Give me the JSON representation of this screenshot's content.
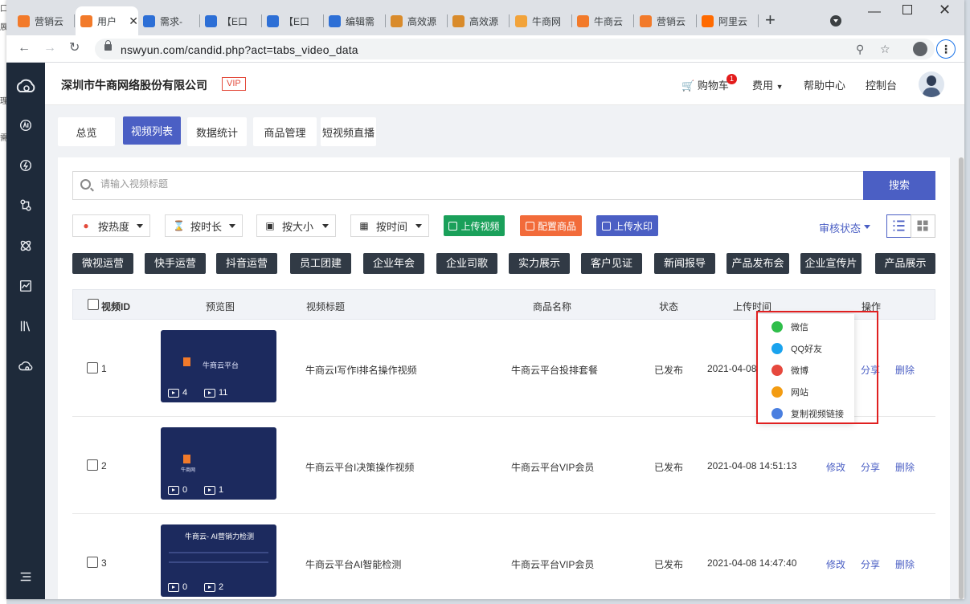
{
  "browser": {
    "tabs": [
      {
        "label": "营销云",
        "icon_color": "#f27a2a",
        "icon": "cloud-icon"
      },
      {
        "label": "用户",
        "icon_color": "#f27a2a",
        "icon": "cloud-icon",
        "active": true
      },
      {
        "label": "需求-",
        "icon_color": "#2d6fd6",
        "icon": "box-icon"
      },
      {
        "label": "【E口",
        "icon_color": "#2d6fd6",
        "icon": "box-icon"
      },
      {
        "label": "【E口",
        "icon_color": "#2d6fd6",
        "icon": "box-icon"
      },
      {
        "label": "编辑需",
        "icon_color": "#2d6fd6",
        "icon": "box-icon"
      },
      {
        "label": "高效源",
        "icon_color": "#d98b2b",
        "icon": "grid-icon"
      },
      {
        "label": "高效源",
        "icon_color": "#d98b2b",
        "icon": "grid-icon"
      },
      {
        "label": "牛商网",
        "icon_color": "#f2a33a",
        "icon": "bull-icon"
      },
      {
        "label": "牛商云",
        "icon_color": "#f27a2a",
        "icon": "cloud-icon"
      },
      {
        "label": "营销云",
        "icon_color": "#f27a2a",
        "icon": "cloud-icon"
      },
      {
        "label": "阿里云",
        "icon_color": "#ff6a00",
        "icon": "aliyun-icon"
      }
    ],
    "new_tab": "+",
    "url": "nswyun.com/candid.php?act=tabs_video_data"
  },
  "header": {
    "company": "深圳市牛商网络股份有限公司",
    "vip": "VIP",
    "cart": "购物车",
    "cart_count": "1",
    "fees": "费用",
    "help": "帮助中心",
    "console": "控制台"
  },
  "subtabs": [
    "总览",
    "视频列表",
    "数据统计",
    "商品管理",
    "短视频直播"
  ],
  "active_subtab": "视频列表",
  "search": {
    "placeholder": "请输入视频标题",
    "button": "搜索"
  },
  "filters": [
    "按热度",
    "按时长",
    "按大小",
    "按时间"
  ],
  "actions": {
    "upload_video": "上传视频",
    "config_product": "配置商品",
    "upload_watermark": "上传水印",
    "review_status": "审核状态"
  },
  "categories": [
    "微视运营",
    "快手运营",
    "抖音运营",
    "员工团建",
    "企业年会",
    "企业司歌",
    "实力展示",
    "客户见证",
    "新闻报导",
    "产品发布会",
    "企业宣传片",
    "产品展示"
  ],
  "table": {
    "columns": [
      "视频ID",
      "预览图",
      "视频标题",
      "商品名称",
      "状态",
      "上传时间",
      "操作"
    ],
    "rows": [
      {
        "id": "1",
        "title": "牛商云I写作I排名操作视频",
        "product": "牛商云平台投排套餐",
        "status": "已发布",
        "time": "2021-04-08",
        "plays": "4",
        "count": "11",
        "thumb_title": "牛商云平台"
      },
      {
        "id": "2",
        "title": "牛商云平台I决策操作视频",
        "product": "牛商云平台VIP会员",
        "status": "已发布",
        "time": "2021-04-08 14:51:13",
        "plays": "0",
        "count": "1",
        "thumb_title": "牛商网"
      },
      {
        "id": "3",
        "title": "牛商云平台AI智能检测",
        "product": "牛商云平台VIP会员",
        "status": "已发布",
        "time": "2021-04-08 14:47:40",
        "plays": "0",
        "count": "2",
        "thumb_title": "牛商云- AI营销力检测"
      }
    ],
    "ops": {
      "edit": "修改",
      "share": "分享",
      "delete": "删除"
    }
  },
  "share_menu": [
    "微信",
    "QQ好友",
    "微博",
    "网站",
    "复制视频链接"
  ],
  "colors": {
    "accent": "#4b5fc4",
    "sidebar": "#1e2a3a",
    "upload_green": "#1aa05a",
    "config_orange": "#f26b3a",
    "watermark_blue": "#4b5fc4",
    "highlight_red": "#e02020"
  }
}
